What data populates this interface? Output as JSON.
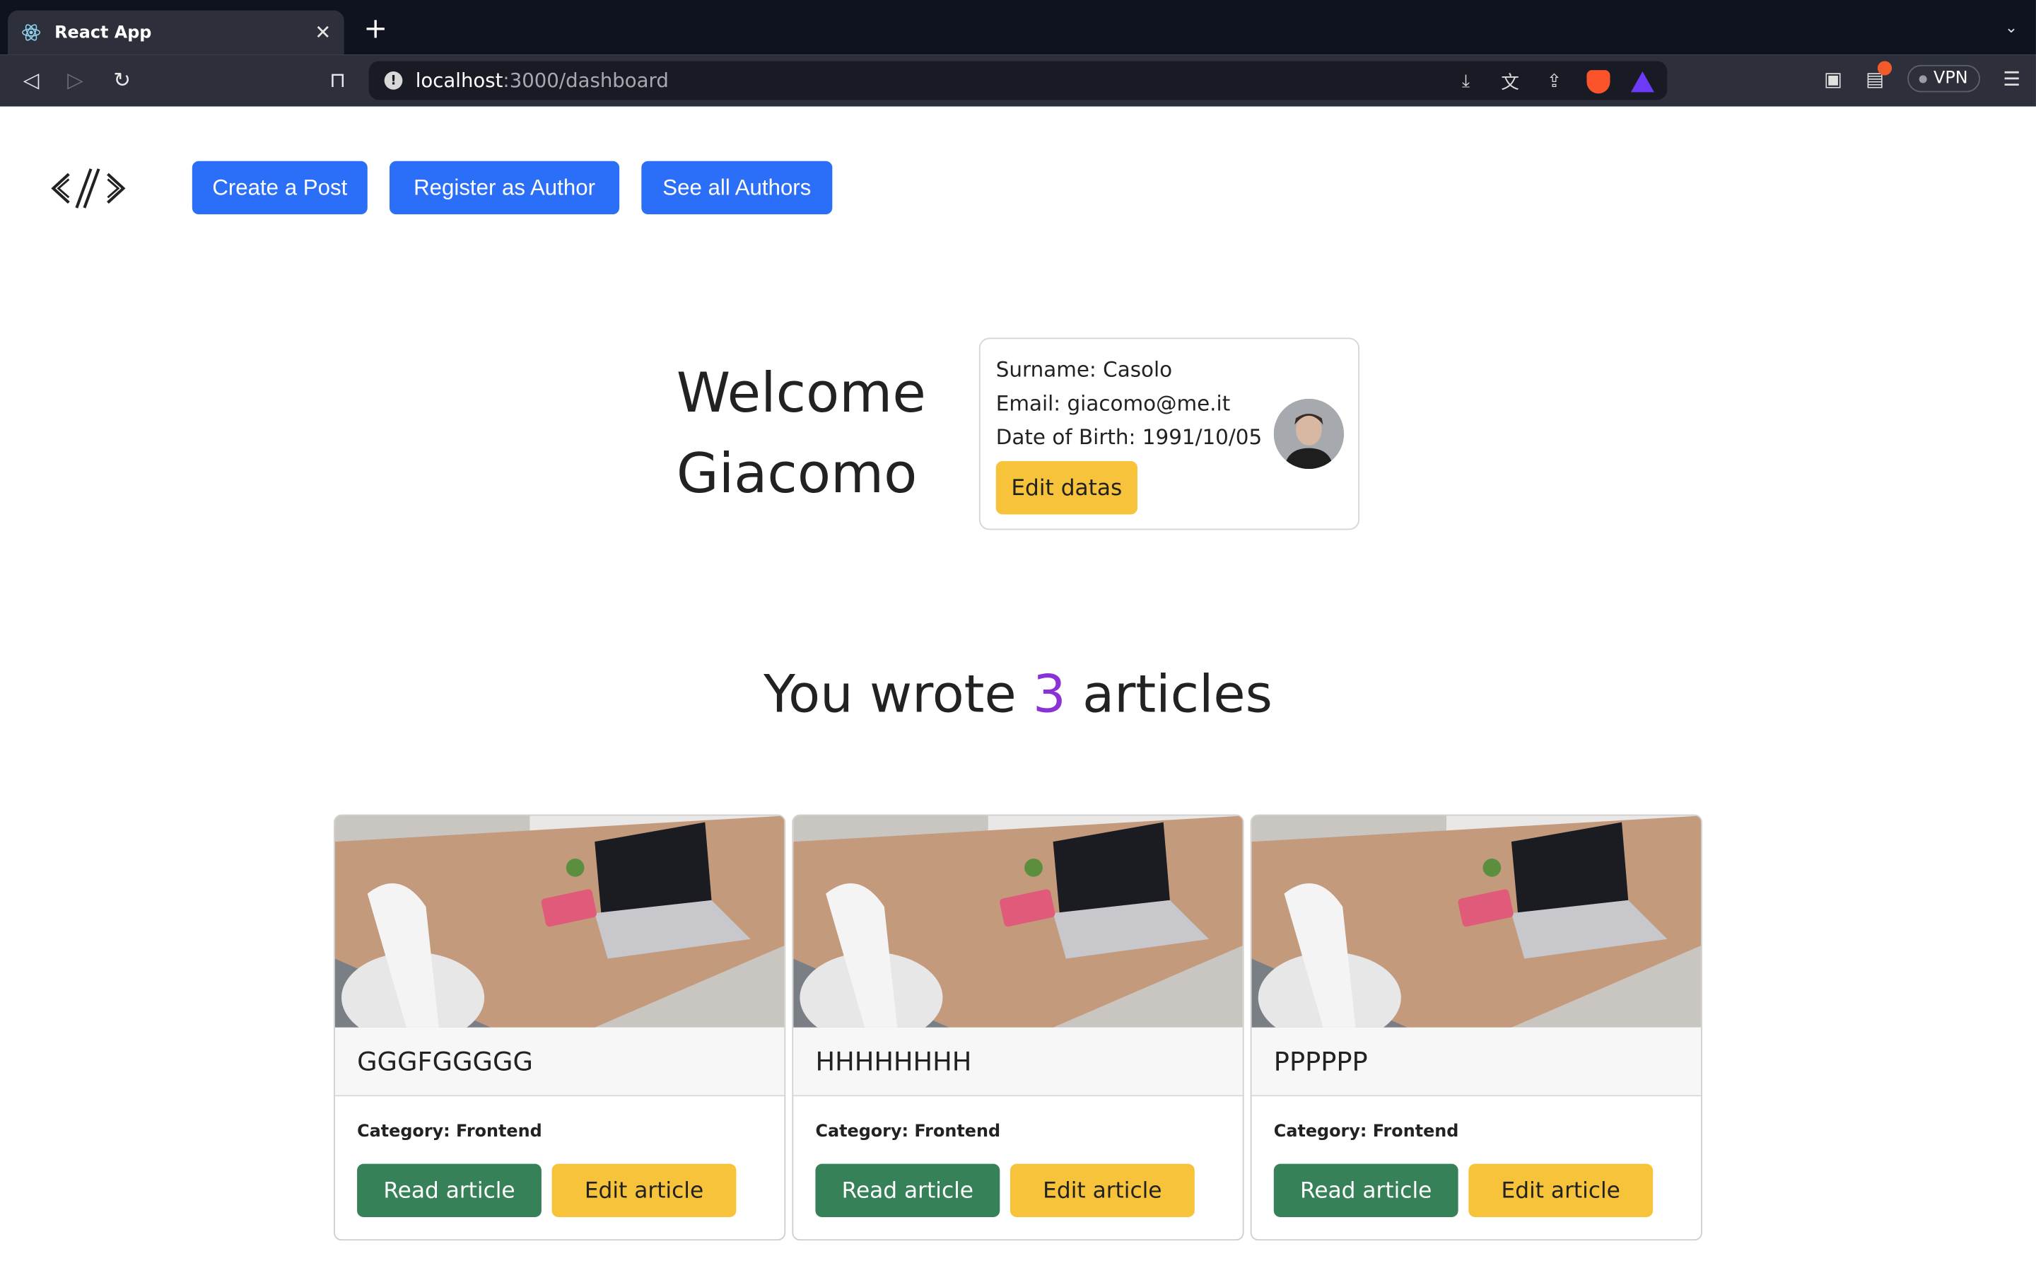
{
  "browser": {
    "tab_title": "React App",
    "tab_close": "✕",
    "new_tab": "+",
    "tab_menu": "⌄",
    "url_host": "localhost",
    "url_path": ":3000/dashboard",
    "vpn_label": "VPN"
  },
  "header": {
    "buttons": [
      "Create a Post",
      "Register as Author",
      "See all Authors"
    ]
  },
  "welcome": {
    "line1": "Welcome",
    "line2": "Giacomo"
  },
  "author": {
    "surname": "Surname: Casolo",
    "email": "Email: giacomo@me.it",
    "dob": "Date of Birth: 1991/10/05",
    "edit_label": "Edit datas"
  },
  "summary": {
    "prefix": "You wrote ",
    "count": "3",
    "suffix": " articles"
  },
  "articles": [
    {
      "title": "GGGFGGGGG",
      "category": "Category: Frontend",
      "read_label": "Read article",
      "edit_label": "Edit article"
    },
    {
      "title": "HHHHHHHH",
      "category": "Category: Frontend",
      "read_label": "Read article",
      "edit_label": "Edit article"
    },
    {
      "title": "PPPPPP",
      "category": "Category: Frontend",
      "read_label": "Read article",
      "edit_label": "Edit article"
    }
  ],
  "colors": {
    "primary": "#2b6ef7",
    "warning": "#f7c33b",
    "success": "#378158",
    "accent": "#8a32d6"
  }
}
